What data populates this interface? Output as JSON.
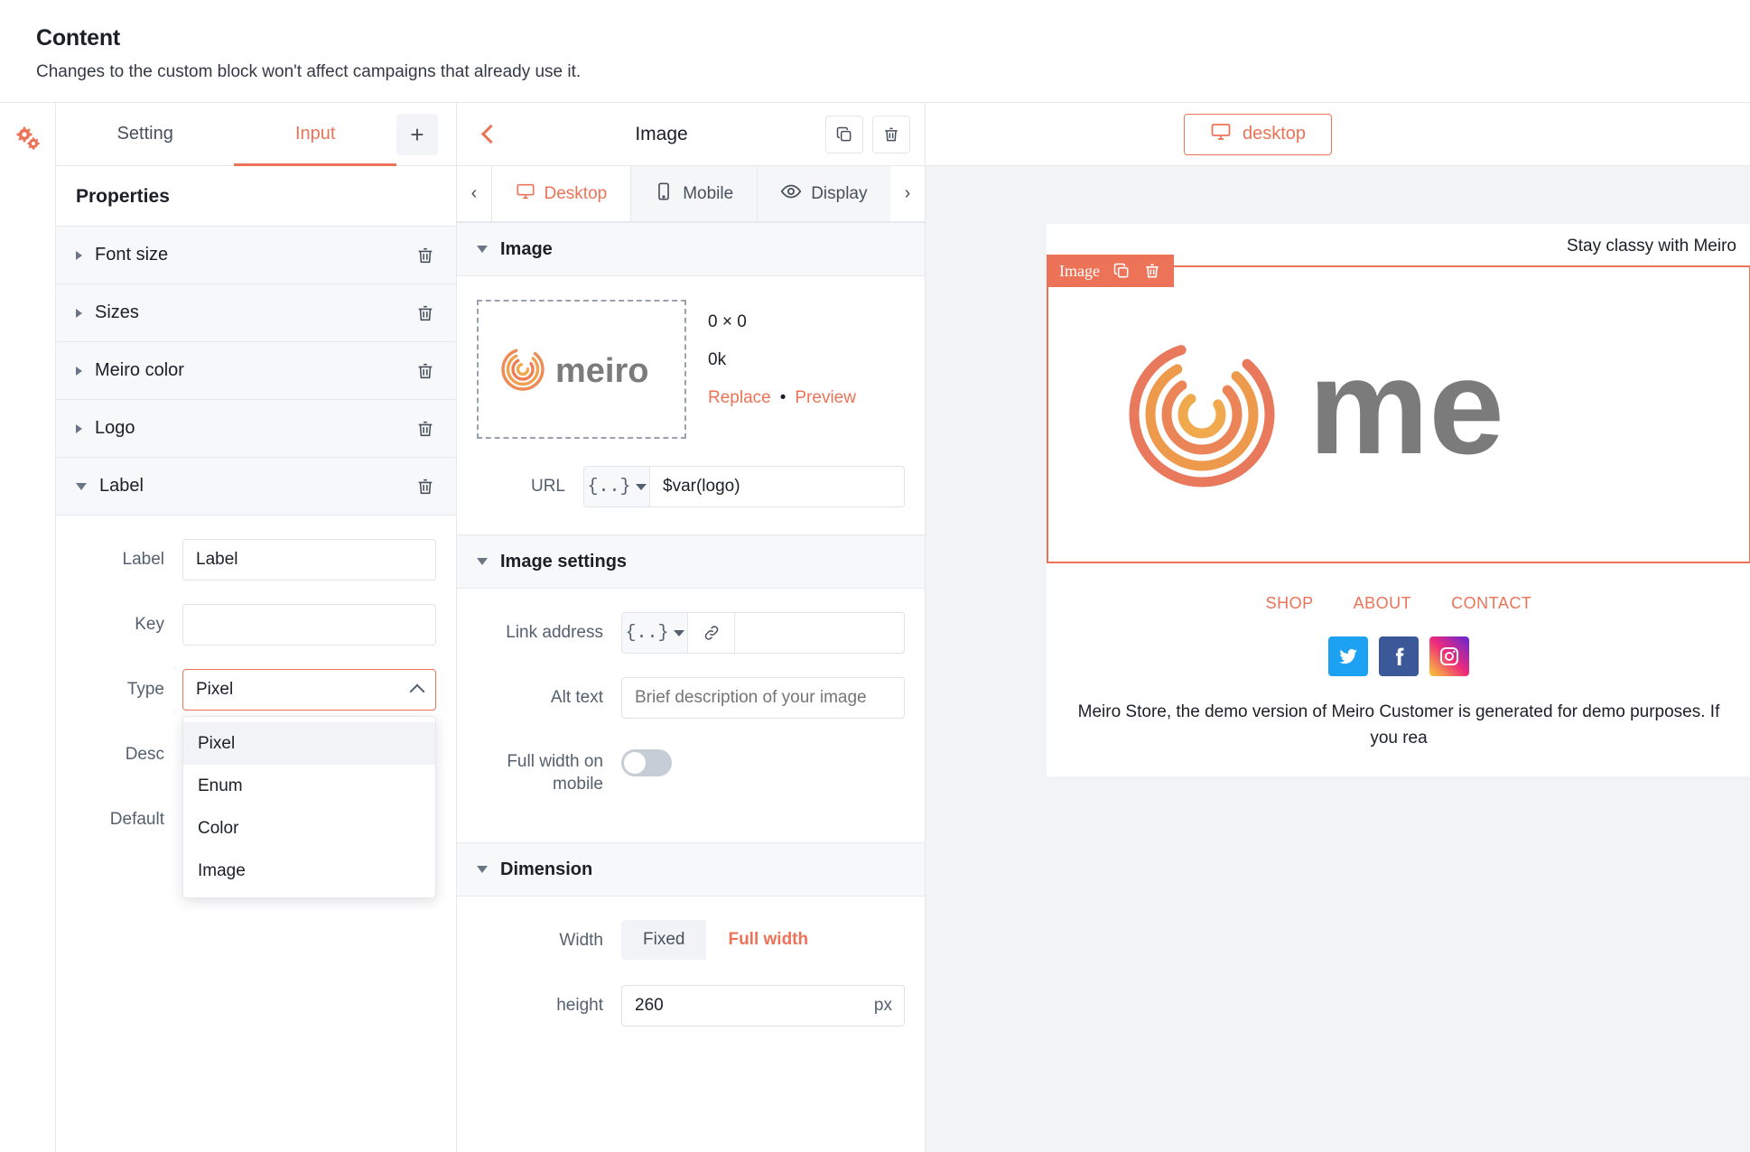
{
  "header": {
    "title": "Content",
    "subtitle": "Changes to the custom block won't affect campaigns that already use it."
  },
  "left_panel": {
    "rail_icon": "gears-icon",
    "tabs": [
      {
        "label": "Setting",
        "active": false
      },
      {
        "label": "Input",
        "active": true
      }
    ],
    "add_button": "+",
    "properties_title": "Properties",
    "properties": [
      {
        "label": "Font size",
        "expanded": false
      },
      {
        "label": "Sizes",
        "expanded": false
      },
      {
        "label": "Meiro color",
        "expanded": false
      },
      {
        "label": "Logo",
        "expanded": false
      },
      {
        "label": "Label",
        "expanded": true
      }
    ],
    "label_form": {
      "label_field": {
        "label": "Label",
        "value": "Label"
      },
      "key_field": {
        "label": "Key",
        "value": ""
      },
      "type_field": {
        "label": "Type",
        "value": "Pixel",
        "options": [
          "Pixel",
          "Enum",
          "Color",
          "Image"
        ],
        "selected_option": "Pixel",
        "open": true
      },
      "desc_field": {
        "label": "Desc",
        "value": ""
      },
      "default_field": {
        "label": "Default",
        "value": ""
      }
    }
  },
  "mid_panel": {
    "back_icon": "chevron-left-icon",
    "title": "Image",
    "duplicate_icon": "duplicate-icon",
    "delete_icon": "trash-icon",
    "device_tabs": {
      "prev_arrow": "chevron-left-icon",
      "next_arrow": "chevron-right-icon",
      "items": [
        {
          "label": "Desktop",
          "icon": "desktop-icon",
          "active": true
        },
        {
          "label": "Mobile",
          "icon": "mobile-icon",
          "active": false
        },
        {
          "label": "Display",
          "icon": "eye-icon",
          "active": false
        }
      ]
    },
    "image_section": {
      "title": "Image",
      "expanded": true,
      "dimensions": "0 × 0",
      "filesize": "0k",
      "replace_label": "Replace",
      "separator": "•",
      "preview_label": "Preview",
      "url_label": "URL",
      "url_var_icon": "{..}",
      "url_value": "$var(logo)"
    },
    "image_settings": {
      "title": "Image settings",
      "expanded": true,
      "link_address_label": "Link address",
      "link_var_icon": "{..}",
      "link_icon": "link-icon",
      "link_value": "",
      "alt_text_label": "Alt text",
      "alt_text_placeholder": "Brief description of your image",
      "alt_text_value": "",
      "full_width_label": "Full width on mobile",
      "full_width_on": false
    },
    "dimension": {
      "title": "Dimension",
      "expanded": true,
      "width_label": "Width",
      "width_options": [
        "Fixed",
        "Full width"
      ],
      "width_selected": "Full width",
      "height_label": "height",
      "height_value": "260",
      "height_unit": "px"
    }
  },
  "right_panel": {
    "device_button": {
      "label": "desktop",
      "icon": "desktop-icon"
    },
    "email": {
      "preheader": "Stay classy with Meiro",
      "block_badge": {
        "label": "Image",
        "duplicate_icon": "duplicate-icon",
        "delete_icon": "trash-icon"
      },
      "nav": [
        "SHOP",
        "ABOUT",
        "CONTACT"
      ],
      "socials": [
        "twitter-icon",
        "facebook-icon",
        "instagram-icon"
      ],
      "body_text": "Meiro Store, the demo version of Meiro Customer is generated for demo purposes. If you rea"
    }
  },
  "colors": {
    "accent": "#ec7357",
    "text": "#1b1f26",
    "muted": "#55606e",
    "panel_bg": "#f6f8fa",
    "border": "#e6e8ec"
  }
}
